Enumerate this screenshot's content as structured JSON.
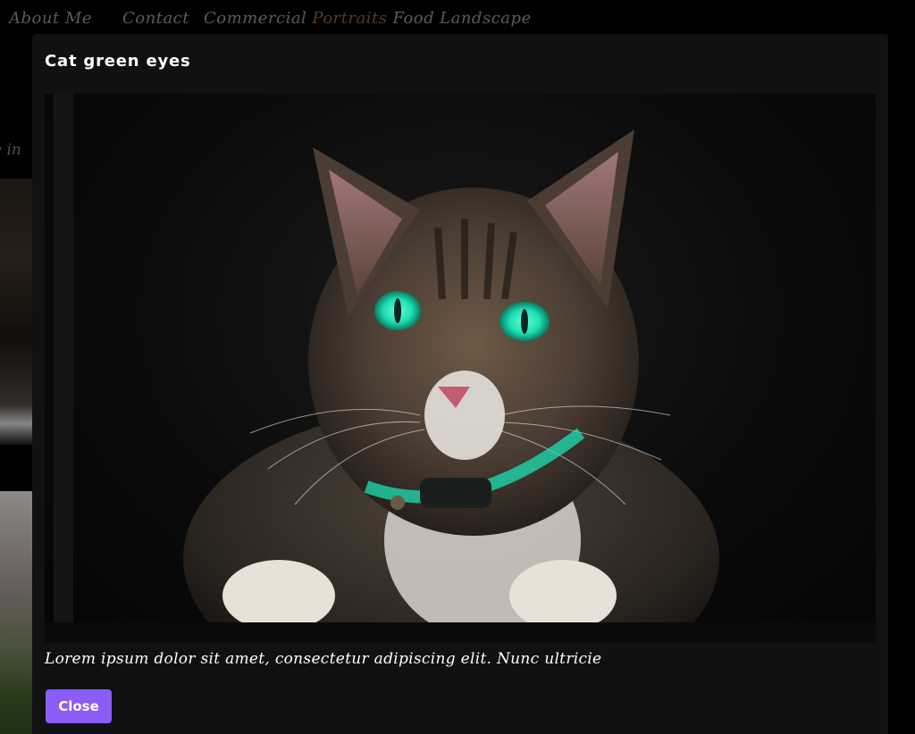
{
  "nav": {
    "items": [
      {
        "label": "About Me"
      },
      {
        "label": "Contact"
      },
      {
        "label": "Commercial"
      },
      {
        "label": "Portraits"
      },
      {
        "label": "Food"
      },
      {
        "label": "Landscape"
      }
    ],
    "active_index": 3
  },
  "background": {
    "partial_text": "e in"
  },
  "modal": {
    "title": "Cat green eyes",
    "image_alt": "cat-photo",
    "caption": "Lorem ipsum dolor sit amet, consectetur adipiscing elit. Nunc ultricie",
    "close_label": "Close"
  },
  "colors": {
    "accent_button": "#8b5cf6",
    "active_nav": "#8a5a34",
    "nav_text": "#8a8a8a",
    "modal_bg": "#111111",
    "eye_color": "#1de0b4"
  },
  "icons": {
    "photo": "cat-image"
  }
}
